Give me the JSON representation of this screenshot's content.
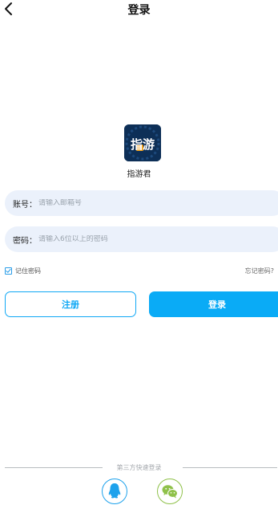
{
  "header": {
    "title": "登录",
    "back_icon": "chevron-left-icon"
  },
  "app": {
    "logo_text": "指游",
    "name": "指游君"
  },
  "form": {
    "account": {
      "label": "账号：",
      "placeholder": "请输入邮箱号",
      "value": ""
    },
    "password": {
      "label": "密码：",
      "placeholder": "请输入6位以上的密码",
      "value": ""
    },
    "remember_label": "记住密码",
    "remember_checked": true,
    "forgot_label": "忘记密码?"
  },
  "buttons": {
    "register_label": "注册",
    "login_label": "登录"
  },
  "third_party": {
    "label": "第三方快速登录",
    "providers": [
      "qq-icon",
      "wechat-icon"
    ]
  },
  "colors": {
    "primary": "#0aabf6",
    "input_bg": "#ebf1fb",
    "wechat": "#8fc14a",
    "logo_bg": "#0d2f57"
  }
}
